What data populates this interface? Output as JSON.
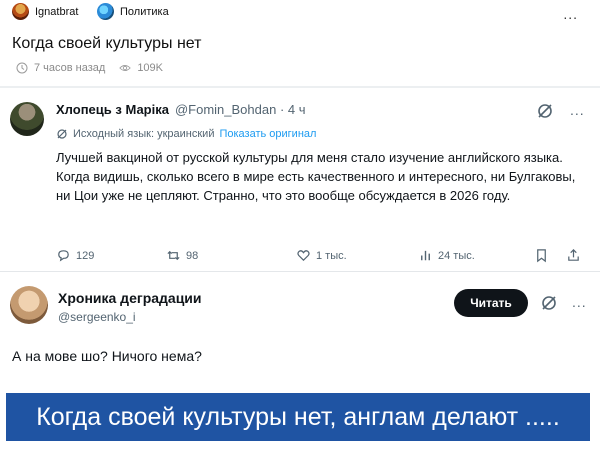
{
  "topbar": {
    "author": "Ignatbrat",
    "category": "Политика",
    "more": "..."
  },
  "post": {
    "title": "Когда своей культуры нет",
    "time": "7 часов назад",
    "views": "109K"
  },
  "tweet1": {
    "name": "Хлопець з Маріка",
    "handle": "@Fomin_Bohdan · 4 ч",
    "translation_note": "Исходный язык: украинский",
    "translation_link": "Показать оригинал",
    "body": "Лучшей вакциной от русской культуры для меня стало изучение английского языка. Когда видишь, сколько всего в мире есть качественного и интересного, ни Булгаковы, ни Цои уже не цепляют. Странно, что это вообще обсуждается в 2026 году.",
    "replies": "129",
    "retweets": "98",
    "likes": "1 тыс.",
    "views": "24 тыс.",
    "more": "..."
  },
  "tweet2": {
    "name": "Хроника деградации",
    "handle": "@sergeenko_i",
    "follow_label": "Читать",
    "body": "А на мове шо? Ничого нема?",
    "more": "..."
  },
  "banner": {
    "text": "Когда своей культуры нет, англам делают ....."
  },
  "colors": {
    "banner_bg": "#1f54a3",
    "link": "#1d9bf0",
    "follow_bg": "#0f1419"
  }
}
